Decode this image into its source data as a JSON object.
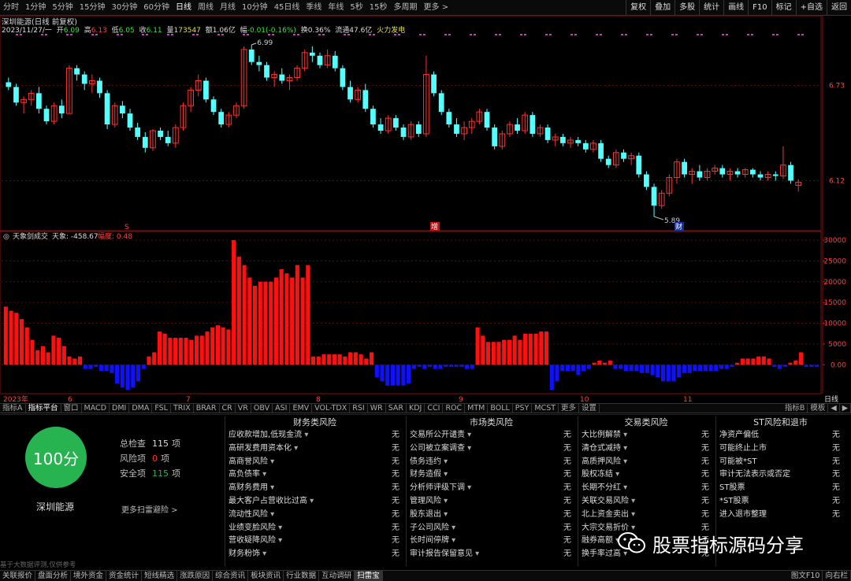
{
  "toolbar": {
    "items": [
      "分时",
      "1分钟",
      "5分钟",
      "15分钟",
      "30分钟",
      "60分钟",
      "日线",
      "周线",
      "月线",
      "10分钟",
      "45日线",
      "季线",
      "年线",
      "5秒",
      "15秒",
      "多周期",
      "更多 >"
    ],
    "active_index": 6,
    "right": [
      "复权",
      "叠加",
      "多股",
      "统计",
      "画线",
      "F10",
      "标记",
      "+自选",
      "返回"
    ]
  },
  "stock": {
    "title": "深圳能源(日线 前复权)",
    "date": "2023/11/27/一",
    "open_label": "开",
    "open": "6.09",
    "high_label": "高",
    "high": "6.13",
    "low_label": "低",
    "low": "6.05",
    "close_label": "收",
    "close": "6.11",
    "volume_label": "量",
    "volume": "173547",
    "amount_label": "额",
    "amount": "1.06亿",
    "change_label": "幅",
    "change": "-0.01(-0.16%)",
    "turnover_label": "换",
    "turnover": "0.36%",
    "float_label": "流通",
    "float": "47.6亿",
    "sector": "火力发电",
    "name": "深圳能源"
  },
  "chart_data": [
    {
      "type": "candlestick",
      "ylim": [
        5.85,
        7.05
      ],
      "yticks": [
        "6.73",
        "6.12"
      ],
      "annotations": [
        {
          "text": "6.99",
          "at": "max"
        },
        {
          "text": "5.89",
          "at": "min"
        }
      ],
      "markers": [
        "S",
        "增",
        "财"
      ],
      "candles": [
        [
          6.75,
          6.78,
          6.7,
          6.72
        ],
        [
          6.72,
          6.74,
          6.6,
          6.62
        ],
        [
          6.62,
          6.66,
          6.55,
          6.64
        ],
        [
          6.64,
          6.7,
          6.6,
          6.68
        ],
        [
          6.68,
          6.72,
          6.55,
          6.58
        ],
        [
          6.58,
          6.6,
          6.48,
          6.5
        ],
        [
          6.5,
          6.62,
          6.48,
          6.6
        ],
        [
          6.6,
          6.64,
          6.52,
          6.55
        ],
        [
          6.55,
          6.86,
          6.55,
          6.84
        ],
        [
          6.84,
          6.86,
          6.76,
          6.8
        ],
        [
          6.8,
          6.82,
          6.7,
          6.74
        ],
        [
          6.74,
          6.8,
          6.68,
          6.76
        ],
        [
          6.76,
          6.78,
          6.65,
          6.68
        ],
        [
          6.68,
          6.7,
          6.45,
          6.48
        ],
        [
          6.48,
          6.62,
          6.46,
          6.6
        ],
        [
          6.6,
          6.63,
          6.52,
          6.55
        ],
        [
          6.55,
          6.58,
          6.44,
          6.46
        ],
        [
          6.46,
          6.49,
          6.38,
          6.4
        ],
        [
          6.4,
          6.43,
          6.3,
          6.33
        ],
        [
          6.33,
          6.45,
          6.31,
          6.44
        ],
        [
          6.44,
          6.46,
          6.38,
          6.4
        ],
        [
          6.4,
          6.44,
          6.34,
          6.36
        ],
        [
          6.36,
          6.48,
          6.33,
          6.46
        ],
        [
          6.46,
          6.62,
          6.44,
          6.6
        ],
        [
          6.6,
          6.72,
          6.56,
          6.7
        ],
        [
          6.7,
          6.8,
          6.66,
          6.76
        ],
        [
          6.76,
          6.78,
          6.62,
          6.64
        ],
        [
          6.64,
          6.66,
          6.54,
          6.56
        ],
        [
          6.56,
          6.58,
          6.46,
          6.48
        ],
        [
          6.48,
          6.56,
          6.46,
          6.54
        ],
        [
          6.54,
          6.62,
          6.52,
          6.6
        ],
        [
          6.6,
          6.98,
          6.58,
          6.96
        ],
        [
          6.96,
          6.99,
          6.86,
          6.88
        ],
        [
          6.88,
          6.92,
          6.82,
          6.86
        ],
        [
          6.86,
          6.88,
          6.76,
          6.78
        ],
        [
          6.78,
          6.82,
          6.72,
          6.8
        ],
        [
          6.8,
          6.84,
          6.74,
          6.76
        ],
        [
          6.76,
          6.8,
          6.7,
          6.78
        ],
        [
          6.78,
          6.86,
          6.76,
          6.84
        ],
        [
          6.84,
          6.96,
          6.82,
          6.94
        ],
        [
          6.94,
          6.98,
          6.88,
          6.92
        ],
        [
          6.92,
          6.94,
          6.84,
          6.86
        ],
        [
          6.86,
          6.96,
          6.84,
          6.92
        ],
        [
          6.92,
          6.95,
          6.82,
          6.84
        ],
        [
          6.84,
          6.86,
          6.7,
          6.72
        ],
        [
          6.72,
          6.76,
          6.62,
          6.64
        ],
        [
          6.64,
          6.72,
          6.62,
          6.7
        ],
        [
          6.7,
          6.74,
          6.56,
          6.58
        ],
        [
          6.58,
          6.6,
          6.46,
          6.48
        ],
        [
          6.48,
          6.52,
          6.42,
          6.44
        ],
        [
          6.44,
          6.54,
          6.42,
          6.52
        ],
        [
          6.52,
          6.54,
          6.44,
          6.46
        ],
        [
          6.46,
          6.48,
          6.38,
          6.4
        ],
        [
          6.4,
          6.5,
          6.38,
          6.48
        ],
        [
          6.48,
          6.5,
          6.4,
          6.42
        ],
        [
          6.42,
          6.92,
          6.4,
          6.8
        ],
        [
          6.8,
          6.82,
          6.66,
          6.68
        ],
        [
          6.68,
          6.7,
          6.54,
          6.56
        ],
        [
          6.56,
          6.58,
          6.46,
          6.48
        ],
        [
          6.48,
          6.52,
          6.4,
          6.42
        ],
        [
          6.42,
          6.5,
          6.38,
          6.46
        ],
        [
          6.46,
          6.52,
          6.42,
          6.5
        ],
        [
          6.5,
          6.58,
          6.48,
          6.56
        ],
        [
          6.56,
          6.58,
          6.44,
          6.46
        ],
        [
          6.46,
          6.48,
          6.32,
          6.34
        ],
        [
          6.34,
          6.44,
          6.32,
          6.42
        ],
        [
          6.42,
          6.5,
          6.4,
          6.48
        ],
        [
          6.48,
          6.52,
          6.42,
          6.44
        ],
        [
          6.44,
          6.56,
          6.42,
          6.54
        ],
        [
          6.54,
          6.56,
          6.4,
          6.42
        ],
        [
          6.42,
          6.48,
          6.4,
          6.46
        ],
        [
          6.46,
          6.48,
          6.36,
          6.38
        ],
        [
          6.38,
          6.42,
          6.34,
          6.4
        ],
        [
          6.4,
          6.42,
          6.34,
          6.36
        ],
        [
          6.36,
          6.4,
          6.33,
          6.38
        ],
        [
          6.38,
          6.4,
          6.34,
          6.36
        ],
        [
          6.36,
          6.38,
          6.3,
          6.32
        ],
        [
          6.32,
          6.38,
          6.3,
          6.36
        ],
        [
          6.36,
          6.38,
          6.24,
          6.26
        ],
        [
          6.26,
          6.28,
          6.2,
          6.22
        ],
        [
          6.22,
          6.32,
          6.2,
          6.3
        ],
        [
          6.3,
          6.32,
          6.24,
          6.26
        ],
        [
          6.26,
          6.3,
          6.22,
          6.28
        ],
        [
          6.28,
          6.3,
          6.14,
          6.16
        ],
        [
          6.16,
          6.18,
          6.06,
          6.08
        ],
        [
          6.08,
          6.1,
          5.89,
          5.96
        ],
        [
          5.96,
          6.06,
          5.94,
          6.04
        ],
        [
          6.04,
          6.16,
          6.02,
          6.14
        ],
        [
          6.14,
          6.26,
          6.1,
          6.24
        ],
        [
          6.24,
          6.26,
          6.14,
          6.16
        ],
        [
          6.16,
          6.2,
          6.1,
          6.18
        ],
        [
          6.18,
          6.22,
          6.12,
          6.14
        ],
        [
          6.14,
          6.2,
          6.12,
          6.18
        ],
        [
          6.18,
          6.22,
          6.16,
          6.2
        ],
        [
          6.2,
          6.22,
          6.14,
          6.16
        ],
        [
          6.16,
          6.2,
          6.12,
          6.18
        ],
        [
          6.18,
          6.2,
          6.14,
          6.16
        ],
        [
          6.16,
          6.2,
          6.14,
          6.19
        ],
        [
          6.19,
          6.2,
          6.14,
          6.16
        ],
        [
          6.16,
          6.18,
          6.12,
          6.14
        ],
        [
          6.14,
          6.18,
          6.12,
          6.16
        ],
        [
          6.16,
          6.18,
          6.12,
          6.15
        ],
        [
          6.15,
          6.34,
          6.13,
          6.22
        ],
        [
          6.22,
          6.24,
          6.1,
          6.12
        ],
        [
          6.09,
          6.13,
          6.05,
          6.11
        ]
      ]
    },
    {
      "type": "bar",
      "title": "天象剑成交",
      "value_label": "天象: -458.67",
      "secondary_label": "幅度: 0.48",
      "ylim": [
        -6000,
        30000
      ],
      "yticks": [
        "30000",
        "25000",
        "20000",
        "15000",
        "10000",
        "5000",
        "0.00"
      ],
      "xticks": [
        "2023年",
        "6",
        "7",
        "8",
        "9",
        "10",
        "11"
      ],
      "values": [
        14000,
        13000,
        12500,
        11000,
        9000,
        6000,
        3500,
        4500,
        3000,
        7000,
        6500,
        4500,
        2000,
        1500,
        2000,
        -1000,
        -1000,
        -500,
        -1500,
        -1500,
        -2000,
        -4500,
        -5500,
        -6000,
        -5500,
        -4000,
        -1000,
        2000,
        3000,
        8000,
        7500,
        6500,
        6500,
        6500,
        6500,
        6000,
        7000,
        7000,
        8000,
        9000,
        9500,
        9000,
        8500,
        30000,
        26000,
        24000,
        21000,
        19000,
        20000,
        20000,
        20000,
        21000,
        23000,
        22000,
        21000,
        24000,
        21000,
        24000,
        2000,
        2000,
        2500,
        2500,
        2500,
        2500,
        2000,
        3000,
        3000,
        2500,
        1500,
        3000,
        -3000,
        -4000,
        -5000,
        -5000,
        -5000,
        -5000,
        -4500,
        -1000,
        -500,
        -1000,
        -500,
        -1000,
        -1000,
        -500,
        -500,
        -500,
        -500,
        -1000,
        -1000,
        9000,
        7000,
        5500,
        5500,
        5500,
        6000,
        6000,
        7000,
        6000,
        7500,
        7500,
        7500,
        8000,
        8000,
        -6000,
        -4000,
        -1500,
        -1500,
        -1500,
        -2500,
        -1500,
        -1000,
        500,
        1000,
        500,
        1000,
        -1000,
        -1000,
        -1500,
        -1500,
        -1500,
        -2000,
        -2000,
        -2500,
        -3000,
        -4000,
        -4000,
        -4000,
        -3000,
        -2000,
        -2000,
        -1500,
        -1500,
        -1500,
        -1500,
        -1500,
        -1000,
        -1000,
        -500,
        500,
        1500,
        1500,
        1500,
        2000,
        2000,
        1500,
        -500,
        -1000,
        -500,
        500,
        1000,
        3000,
        -500,
        -500,
        -500
      ]
    }
  ],
  "indicator_tabs": {
    "items": [
      "指标A",
      "指标平台",
      "窗口",
      "MACD",
      "DMI",
      "DMA",
      "FSL",
      "TRIX",
      "BRAR",
      "CR",
      "VR",
      "OBV",
      "ASI",
      "EMV",
      "VOL-TDX",
      "RSI",
      "WR",
      "SAR",
      "KDJ",
      "CCI",
      "ROC",
      "MTM",
      "BOLL",
      "PSY",
      "MCST",
      "更多",
      "设置"
    ],
    "right": [
      "指标B",
      "模板",
      "◀",
      "▶"
    ]
  },
  "risk": {
    "score": "100分",
    "summary": [
      {
        "label": "总检查",
        "value": "115",
        "unit": "项",
        "color": "#dddddd"
      },
      {
        "label": "风险项",
        "value": "0",
        "unit": "项",
        "color": "#ff3333"
      },
      {
        "label": "安全项",
        "value": "115",
        "unit": "项",
        "color": "#27b34f"
      }
    ],
    "more_scan": "更多扫雷避险 >",
    "columns": [
      {
        "title": "财务类风险",
        "items": [
          "应收款增加,低现金流",
          "高研发费用资本化",
          "高商誉风险",
          "高负债率",
          "高财务费用",
          "最大客户占营收比过高",
          "流动性风险",
          "业绩变脸风险",
          "营收疑降风险",
          "财务粉饰"
        ]
      },
      {
        "title": "市场类风险",
        "items": [
          "交易所公开谴责",
          "公司被立案调查",
          "债务违约",
          "财务造假",
          "分析师评级下调",
          "管理风险",
          "股东退出",
          "子公司风险",
          "长时间停牌",
          "审计报告保留意见"
        ]
      },
      {
        "title": "交易类风险",
        "items": [
          "大比例解禁",
          "清仓式减持",
          "高质押风险",
          "股权冻结",
          "长期不分红",
          "关联交易风险",
          "北上资金卖出",
          "大宗交易折价",
          "融券高额",
          "换手率过高"
        ]
      },
      {
        "title": "ST风险和退市",
        "items": [
          "净资产偏低",
          "可能终止上市",
          "可能被*ST",
          "审计无法表示或否定",
          "ST股票",
          "*ST股票",
          "进入退市整理"
        ]
      }
    ],
    "status_text": "无"
  },
  "footnote": "基于大数据评测,仅供参考",
  "watermark": "股票指标源码分享",
  "bottom_tabs": {
    "items": [
      "关联报价",
      "盘面分析",
      "境外资金",
      "资金统计",
      "短线精选",
      "涨跌原因",
      "综合资讯",
      "板块资讯",
      "行业数据",
      "互动调研",
      "扫雷宝"
    ],
    "selected": 10,
    "right": [
      "图文F10",
      "向右栏"
    ]
  }
}
